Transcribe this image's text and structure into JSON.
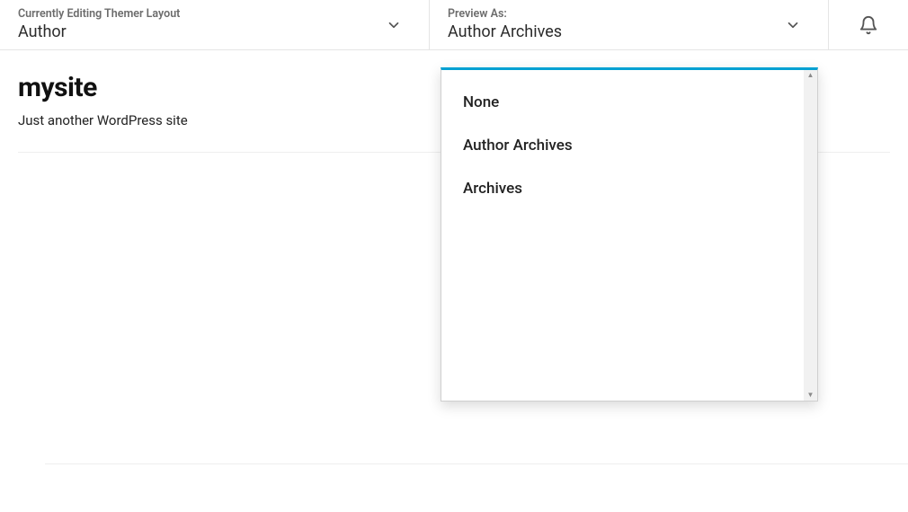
{
  "header": {
    "layout": {
      "label": "Currently Editing Themer Layout",
      "value": "Author"
    },
    "preview": {
      "label": "Preview As:",
      "value": "Author Archives"
    }
  },
  "site": {
    "title": "mysite",
    "tagline": "Just another WordPress site"
  },
  "dropdown": {
    "items": [
      {
        "label": "None"
      },
      {
        "label": "Author Archives"
      },
      {
        "label": "Archives"
      }
    ]
  }
}
